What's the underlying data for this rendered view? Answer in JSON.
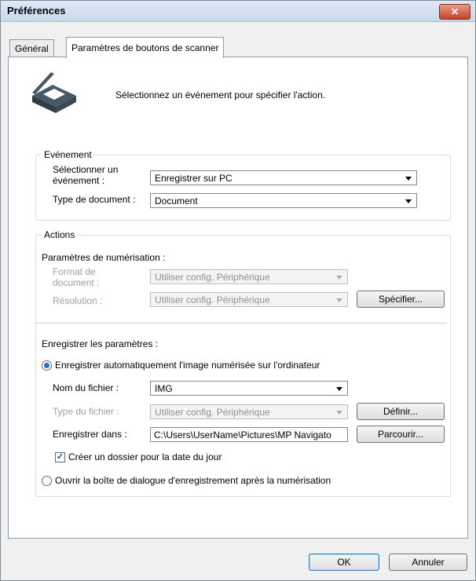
{
  "window": {
    "title": "Préférences"
  },
  "tabs": [
    {
      "label": "Général",
      "active": false
    },
    {
      "label": "Paramètres de boutons de scanner",
      "active": true
    }
  ],
  "intro": {
    "text": "Sélectionnez un événement pour spécifier l'action."
  },
  "event_group": {
    "legend": "Evénement",
    "select_event_label_line1": "Sélectionner un",
    "select_event_label_line2": "événement :",
    "select_event_value": "Enregistrer sur PC",
    "document_type_label": "Type de document :",
    "document_type_value": "Document"
  },
  "actions_group": {
    "legend": "Actions",
    "scan_settings_heading": "Paramètres de numérisation :",
    "document_size_label_line1": "Format de",
    "document_size_label_line2": "document :",
    "document_size_value": "Utiliser config. Périphérique",
    "resolution_label": "Résolution :",
    "resolution_value": "Utiliser config. Périphérique",
    "specify_button": "Spécifier...",
    "save_settings_heading": "Enregistrer les paramètres :",
    "radio_auto_save": "Enregistrer automatiquement l'image numérisée sur l'ordinateur",
    "radio_auto_save_checked": true,
    "file_name_label": "Nom du fichier :",
    "file_name_value": "IMG",
    "file_type_label": "Type du fichier :",
    "file_type_value": "Utiliser config. Périphérique",
    "define_button": "Définir...",
    "save_in_label": "Enregistrer dans :",
    "save_in_value": "C:\\Users\\UserName\\Pictures\\MP Navigato",
    "browse_button": "Parcourir...",
    "create_folder_checkbox": "Créer un dossier pour la date du jour",
    "create_folder_checked": true,
    "radio_open_dialog": "Ouvrir la boîte de dialogue d'enregistrement après la numérisation",
    "radio_open_dialog_checked": false
  },
  "footer": {
    "ok_button": "OK",
    "cancel_button": "Annuler"
  },
  "icons": {
    "close": "close-icon",
    "scanner": "scanner-icon",
    "dropdown": "chevron-down-icon"
  }
}
